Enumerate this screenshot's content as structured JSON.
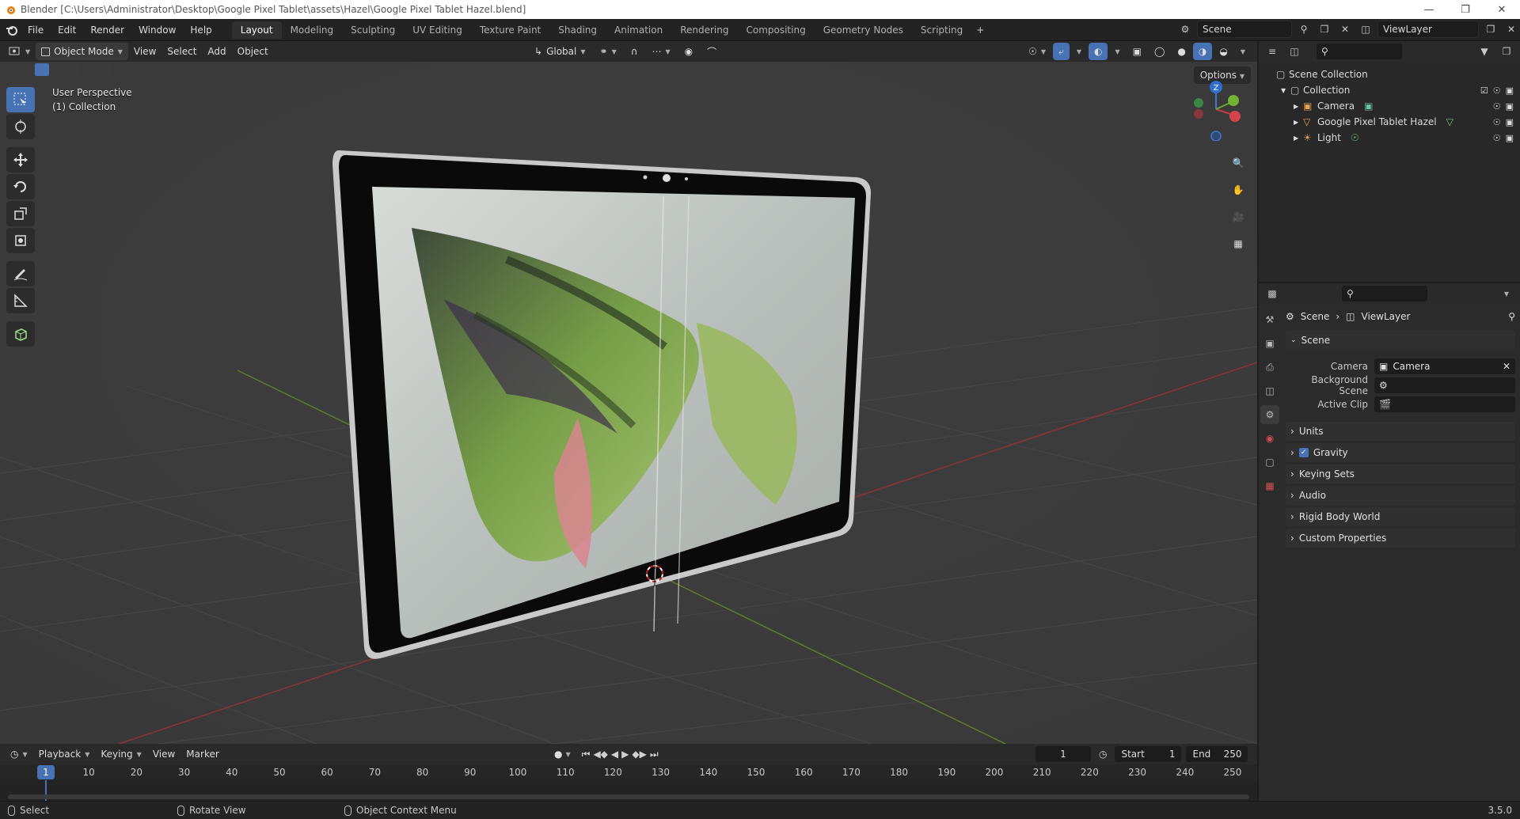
{
  "window": {
    "title": "Blender [C:\\Users\\Administrator\\Desktop\\Google Pixel Tablet\\assets\\Hazel\\Google Pixel Tablet Hazel.blend]"
  },
  "menu": [
    "File",
    "Edit",
    "Render",
    "Window",
    "Help"
  ],
  "workspaces": [
    "Layout",
    "Modeling",
    "Sculpting",
    "UV Editing",
    "Texture Paint",
    "Shading",
    "Animation",
    "Rendering",
    "Compositing",
    "Geometry Nodes",
    "Scripting"
  ],
  "active_workspace": "Layout",
  "scene_field": "Scene",
  "viewlayer_field": "ViewLayer",
  "viewport": {
    "mode": "Object Mode",
    "menus": [
      "View",
      "Select",
      "Add",
      "Object"
    ],
    "orientation": "Global",
    "options_label": "Options",
    "overlay_line1": "User Perspective",
    "overlay_line2": "(1) Collection",
    "gizmo_z": "Z"
  },
  "outliner": {
    "root": "Scene Collection",
    "collection": "Collection",
    "items": [
      "Camera",
      "Google Pixel Tablet Hazel",
      "Light"
    ]
  },
  "properties": {
    "breadcrumb_scene": "Scene",
    "breadcrumb_viewlayer": "ViewLayer",
    "panel_scene": "Scene",
    "camera_label": "Camera",
    "camera_value": "Camera",
    "background_scene_label": "Background Scene",
    "active_clip_label": "Active Clip",
    "panels": [
      "Units",
      "Gravity",
      "Keying Sets",
      "Audio",
      "Rigid Body World",
      "Custom Properties"
    ]
  },
  "timeline": {
    "menus": [
      "Playback",
      "Keying",
      "View",
      "Marker"
    ],
    "current_frame": "1",
    "start_label": "Start",
    "start_value": "1",
    "end_label": "End",
    "end_value": "250",
    "ruler": [
      "1",
      "10",
      "20",
      "30",
      "40",
      "50",
      "60",
      "70",
      "80",
      "90",
      "100",
      "110",
      "120",
      "130",
      "140",
      "150",
      "160",
      "170",
      "180",
      "190",
      "200",
      "210",
      "220",
      "230",
      "240",
      "250"
    ]
  },
  "status": {
    "select": "Select",
    "rotate": "Rotate View",
    "context": "Object Context Menu",
    "version": "3.5.0"
  },
  "colors": {
    "accent": "#4772b3",
    "x_axis": "#c0403f",
    "y_axis": "#6a9a2a"
  }
}
